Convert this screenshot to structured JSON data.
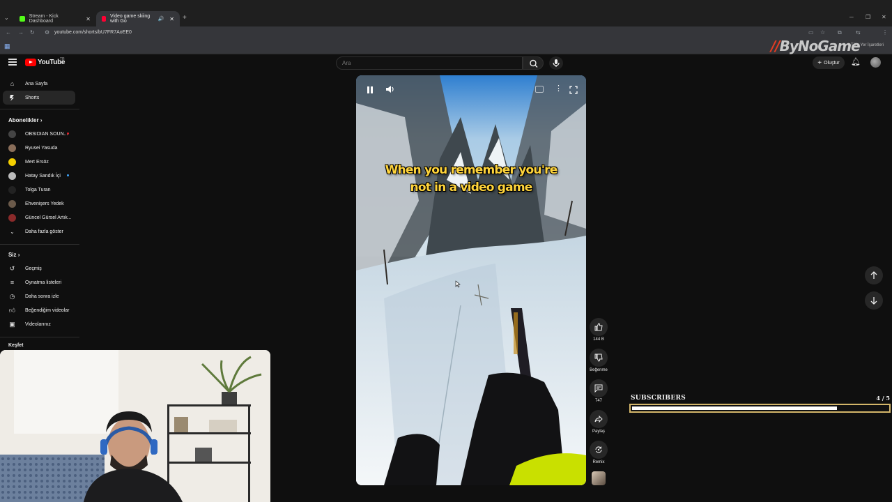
{
  "browser": {
    "tabs": [
      {
        "title": "Stream - Kick Dashboard",
        "fav_color": "#53fc18"
      },
      {
        "title": "Video game skiing with Go",
        "fav_color": "#ff0033"
      }
    ],
    "url": "youtube.com/shorts/bU7FR7AoEE0",
    "bookmarks_label": "Tüm Yer İşaretleri"
  },
  "watermark": {
    "mark": "//",
    "text": "ByNoGame"
  },
  "header": {
    "logo_text": "YouTube",
    "country": "TR",
    "search_placeholder": "Ara",
    "create_label": "Oluştur"
  },
  "sidebar": {
    "home": "Ana Sayfa",
    "shorts": "Shorts",
    "subscriptions_title": "Abonelikler",
    "channels": [
      {
        "name": "OBSIDIAN SOUN...",
        "color": "#444",
        "live": true,
        "dot": "#e0242c"
      },
      {
        "name": "Ryusei Yasuda",
        "color": "#8a6e5a",
        "live": false,
        "dot": ""
      },
      {
        "name": "Mert Ersöz",
        "color": "#f5d000",
        "live": false,
        "dot": ""
      },
      {
        "name": "Hatay Sandık İçi",
        "color": "#bcbcbc",
        "live": true,
        "dot": "#3ea6ff"
      },
      {
        "name": "Tolga Turan",
        "color": "#222",
        "live": false,
        "dot": ""
      },
      {
        "name": "Ehvenişers Yedek",
        "color": "#6b5a4a",
        "live": false,
        "dot": ""
      },
      {
        "name": "Güncel Gürsel Artık...",
        "color": "#8a2a2a",
        "live": false,
        "dot": ""
      }
    ],
    "show_more": "Daha fazla göster",
    "you_title": "Siz",
    "you_items": [
      "Geçmiş",
      "Oynatma listeleri",
      "Daha sonra izle",
      "Beğendiğim videolar",
      "Videolarınız"
    ],
    "explore_title": "Keşfet"
  },
  "short": {
    "caption_line1": "When you remember you're",
    "caption_line2": "not in a video game"
  },
  "actions": {
    "likes": "144 B",
    "dislike": "Beğenme",
    "comments": "747",
    "share": "Paylaş",
    "remix": "Remix"
  },
  "subscribers": {
    "label": "SUBSCRIBERS",
    "count": "4 / 5",
    "progress": 0.8
  }
}
